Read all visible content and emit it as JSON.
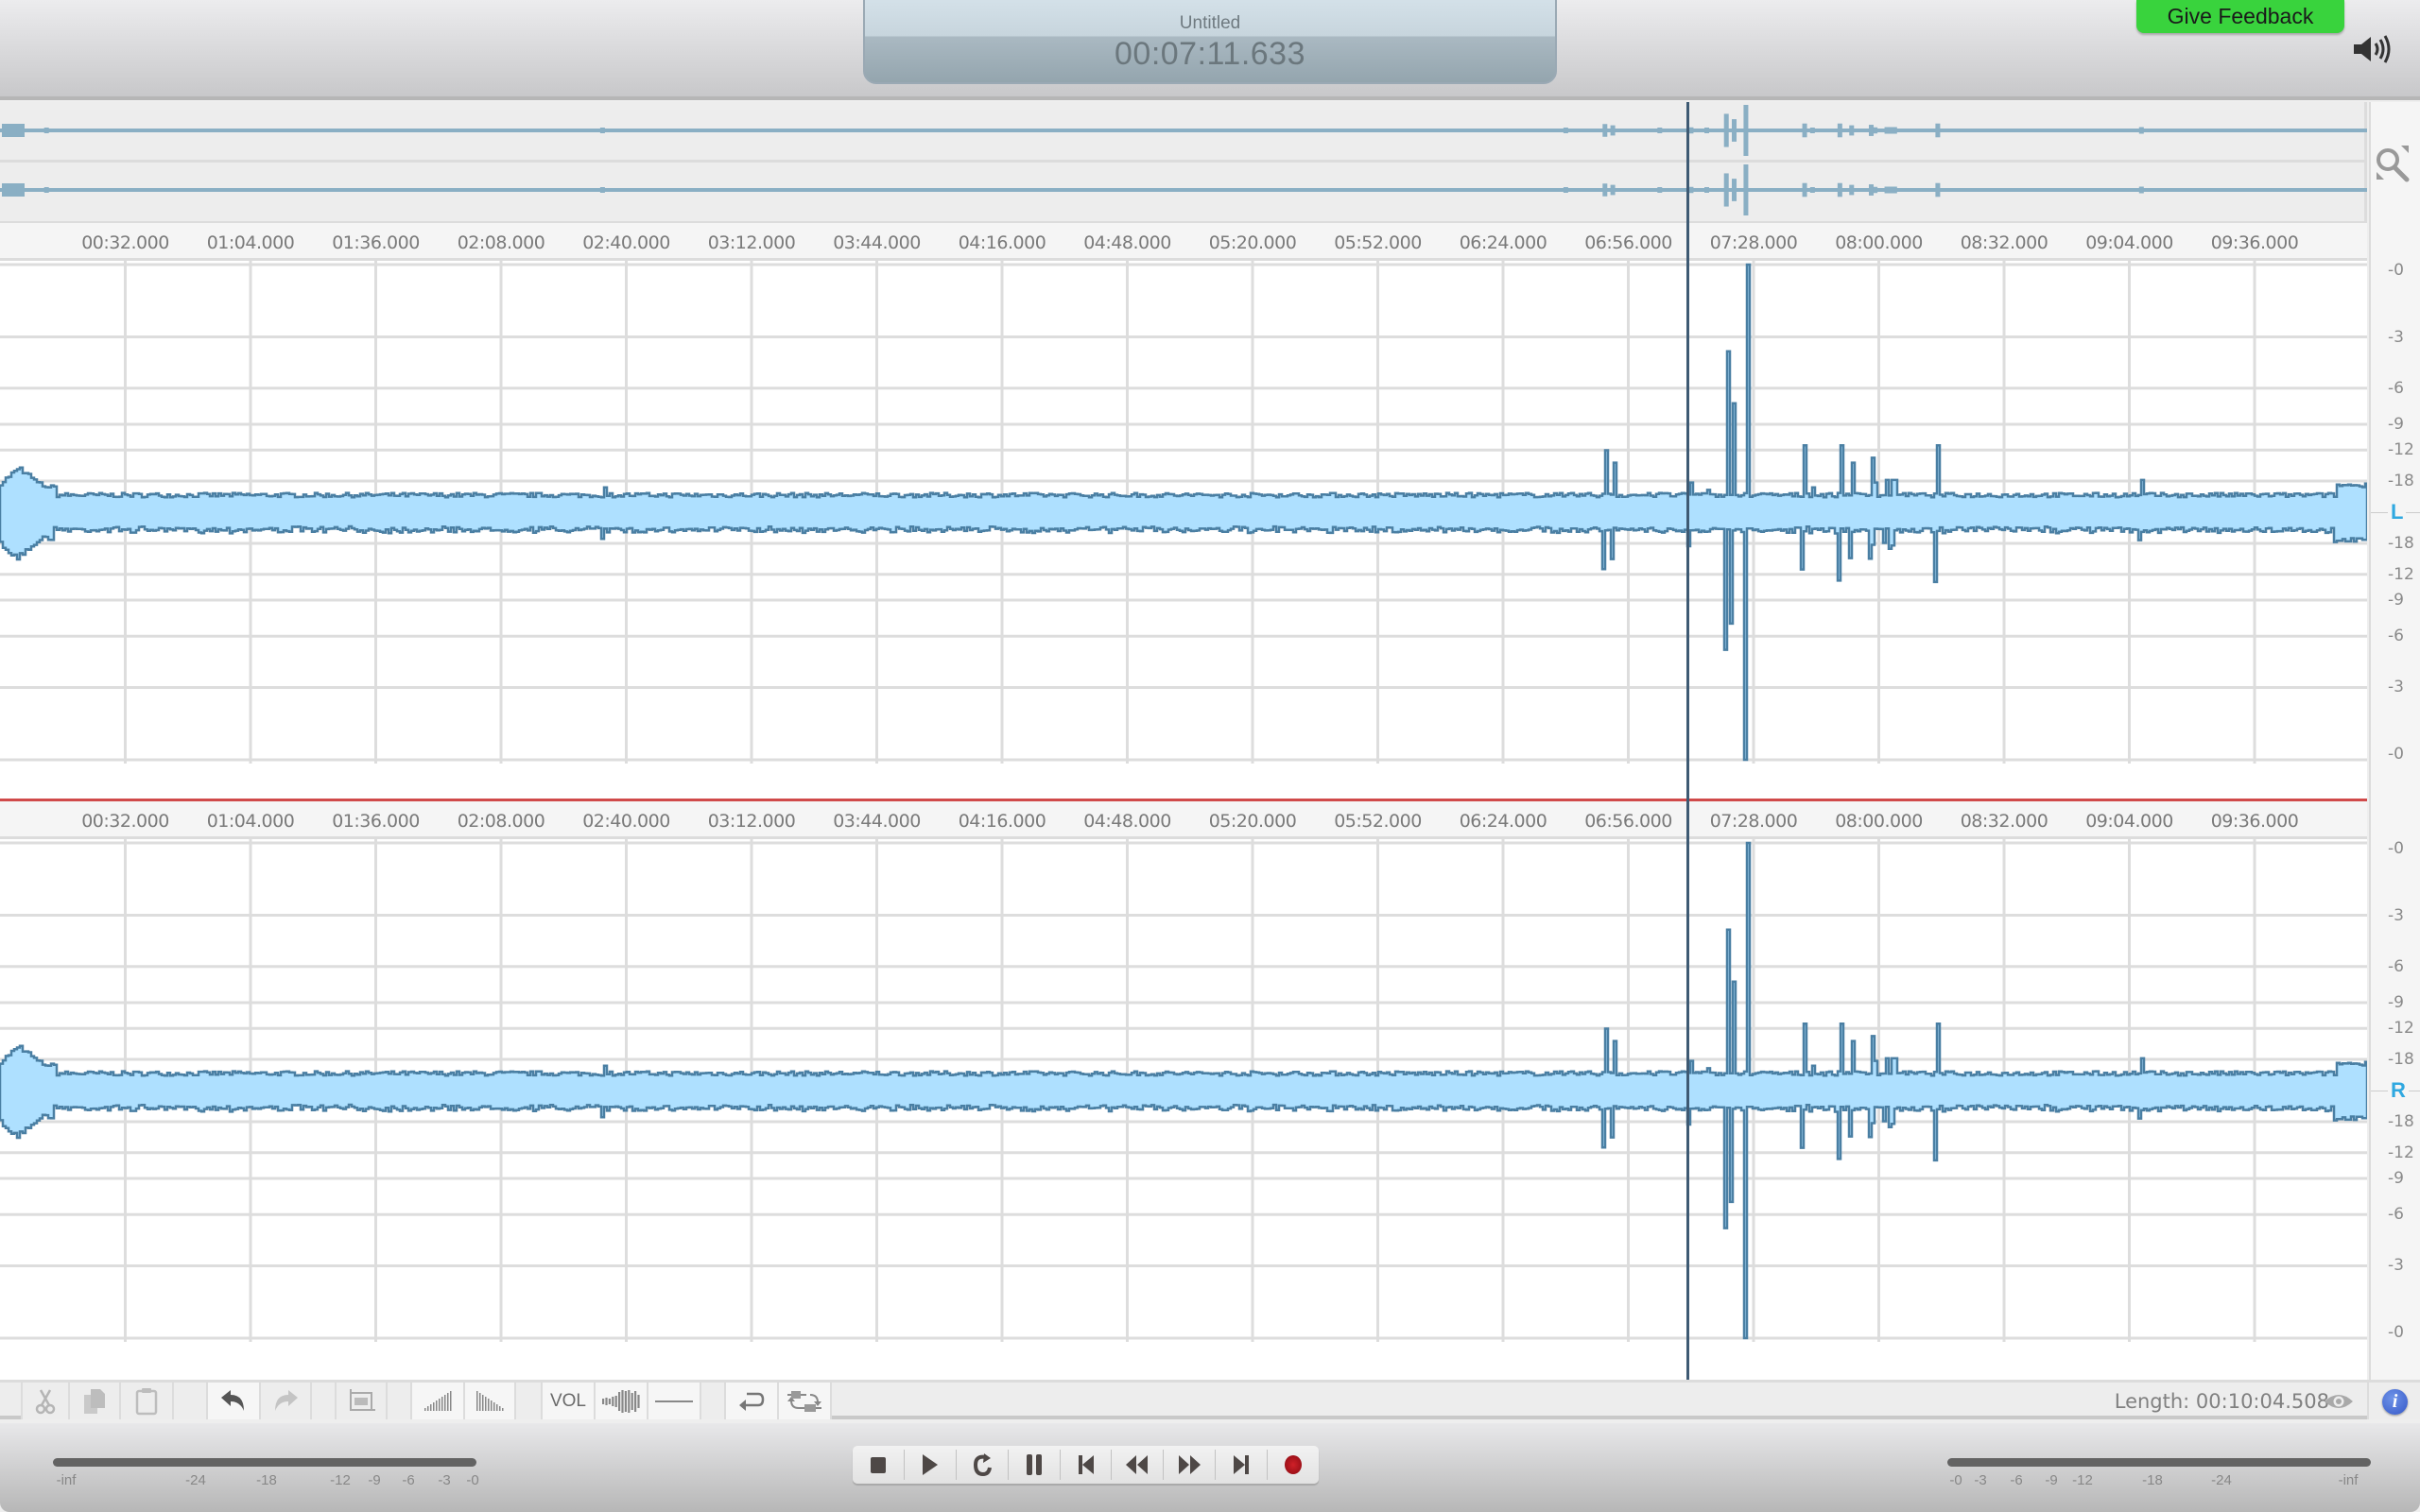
{
  "header": {
    "document_title": "Untitled",
    "current_time": "00:07:11.633",
    "feedback_label": "Give Feedback"
  },
  "timeline": {
    "ruler_labels": [
      "00:32.000",
      "01:04.000",
      "01:36.000",
      "02:08.000",
      "02:40.000",
      "03:12.000",
      "03:44.000",
      "04:16.000",
      "04:48.000",
      "05:20.000",
      "05:52.000",
      "06:24.000",
      "06:56.000",
      "07:28.000",
      "08:00.000",
      "08:32.000",
      "09:04.000",
      "09:36.000"
    ],
    "playhead_time": "00:07:11.633",
    "total_length": "00:10:04.508"
  },
  "channels": [
    {
      "badge": "L",
      "db_scale": [
        "-0",
        "-3",
        "-6",
        "-9",
        "-12",
        "-18",
        "-18",
        "-12",
        "-9",
        "-6",
        "-3",
        "-0"
      ]
    },
    {
      "badge": "R",
      "db_scale": [
        "-0",
        "-3",
        "-6",
        "-9",
        "-12",
        "-18",
        "-18",
        "-12",
        "-9",
        "-6",
        "-3",
        "-0"
      ]
    }
  ],
  "waveform_peaks": [
    {
      "t": 5,
      "amp": 0.18
    },
    {
      "t": 12,
      "amp": 0.1
    },
    {
      "t": 154,
      "amp": 0.1
    },
    {
      "t": 400,
      "amp": 0.03
    },
    {
      "t": 410,
      "amp": 0.25
    },
    {
      "t": 412,
      "amp": 0.2
    },
    {
      "t": 424,
      "amp": 0.06
    },
    {
      "t": 432,
      "amp": 0.12
    },
    {
      "t": 436,
      "amp": 0.09
    },
    {
      "t": 441,
      "amp": 0.65
    },
    {
      "t": 443,
      "amp": 0.44
    },
    {
      "t": 446,
      "amp": 1.0
    },
    {
      "t": 461,
      "amp": 0.27
    },
    {
      "t": 463,
      "amp": 0.1
    },
    {
      "t": 470,
      "amp": 0.27
    },
    {
      "t": 473,
      "amp": 0.2
    },
    {
      "t": 478,
      "amp": 0.22
    },
    {
      "t": 479,
      "amp": 0.12
    },
    {
      "t": 482,
      "amp": 0.13
    },
    {
      "t": 483,
      "amp": 0.13
    },
    {
      "t": 484,
      "amp": 0.13
    },
    {
      "t": 495,
      "amp": 0.27
    },
    {
      "t": 547,
      "amp": 0.13
    }
  ],
  "toolbar": {
    "vol_label": "VOL",
    "length_label": "Length: 00:10:04.508"
  },
  "meters": {
    "left_labels": [
      "-inf",
      "-24",
      "-18",
      "-12",
      "-9",
      "-6",
      "-3",
      "-0"
    ],
    "right_labels": [
      "-0",
      "-3",
      "-6",
      "-9",
      "-12",
      "-18",
      "-24",
      "-inf"
    ]
  },
  "transport": [
    "stop",
    "play",
    "loop",
    "pause",
    "go-to-start",
    "rewind",
    "fast-forward",
    "go-to-end",
    "record"
  ],
  "colors": {
    "waveform_fill": "#aee0ff",
    "waveform_stroke": "#4a7fa3",
    "overview_wave": "#8aafc4",
    "playhead": "#3e5a73",
    "channel_separator": "#d04a4a",
    "channel_badge": "#2fa8e0",
    "feedback_button": "#39d33d",
    "record": "#b0141c"
  }
}
